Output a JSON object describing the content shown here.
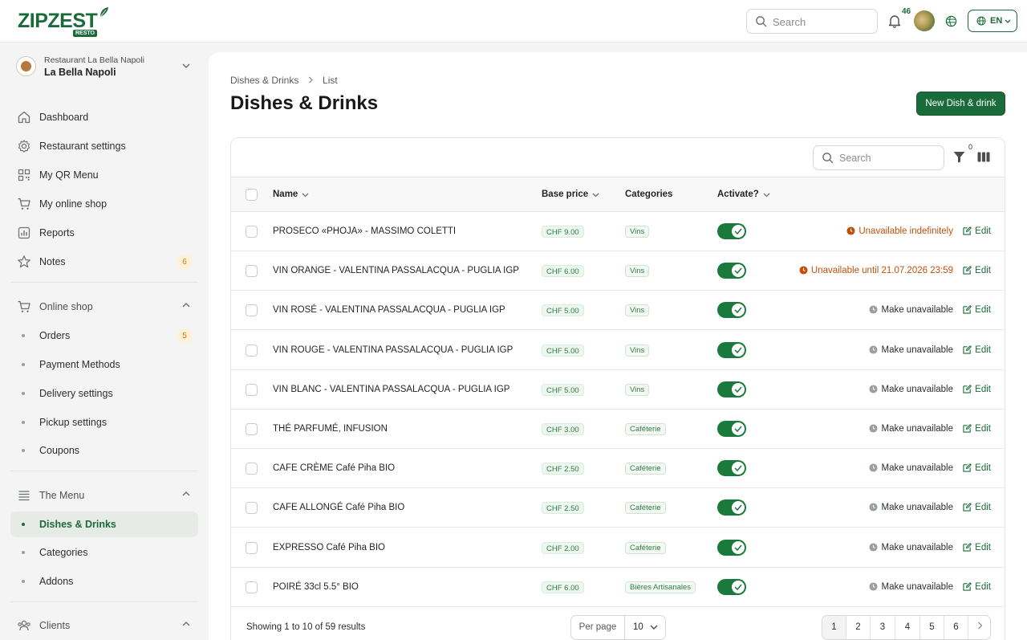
{
  "brand": {
    "name": "ZIPZEST",
    "badge": "RESTO"
  },
  "topbar": {
    "search_placeholder": "Search",
    "notifications_count": "46",
    "language": "EN"
  },
  "restaurant": {
    "subtitle": "Restaurant La Bella Napoli",
    "name": "La Bella Napoli"
  },
  "sidebar": {
    "items": [
      {
        "label": "Dashboard"
      },
      {
        "label": "Restaurant settings"
      },
      {
        "label": "My QR Menu"
      },
      {
        "label": "My online shop"
      },
      {
        "label": "Reports"
      },
      {
        "label": "Notes",
        "badge": "6"
      }
    ],
    "online_shop": {
      "label": "Online shop",
      "children": [
        {
          "label": "Orders",
          "badge": "5"
        },
        {
          "label": "Payment Methods"
        },
        {
          "label": "Delivery settings"
        },
        {
          "label": "Pickup settings"
        },
        {
          "label": "Coupons"
        }
      ]
    },
    "menu": {
      "label": "The Menu",
      "children": [
        {
          "label": "Dishes & Drinks"
        },
        {
          "label": "Categories"
        },
        {
          "label": "Addons"
        }
      ]
    },
    "clients": {
      "label": "Clients"
    }
  },
  "main": {
    "breadcrumb": [
      "Dishes & Drinks",
      "List"
    ],
    "title": "Dishes & Drinks",
    "new_button": "New Dish & drink",
    "table_search_placeholder": "Search",
    "filter_count": "0",
    "columns": {
      "name": "Name",
      "price": "Base price",
      "categories": "Categories",
      "activate": "Activate?"
    },
    "rows": [
      {
        "name": "PROSECO «PHOJA» - MASSIMO COLETTI",
        "price": "CHF 9.00",
        "category": "Vins",
        "status": "Unavailable indefinitely",
        "warn": true
      },
      {
        "name": "VIN ORANGE - VALENTINA PASSALACQUA - PUGLIA IGP",
        "price": "CHF 6.00",
        "category": "Vins",
        "status": "Unavailable until 21.07.2026 23:59",
        "warn": true
      },
      {
        "name": "VIN ROSÉ - VALENTINA PASSALACQUA - PUGLIA IGP",
        "price": "CHF 5.00",
        "category": "Vins",
        "status": "Make unavailable",
        "warn": false
      },
      {
        "name": "VIN ROUGE - VALENTINA PASSALACQUA - PUGLIA IGP",
        "price": "CHF 5.00",
        "category": "Vins",
        "status": "Make unavailable",
        "warn": false
      },
      {
        "name": "VIN BLANC - VALENTINA PASSALACQUA - PUGLIA IGP",
        "price": "CHF 5.00",
        "category": "Vins",
        "status": "Make unavailable",
        "warn": false
      },
      {
        "name": "THÉ PARFUMÉ, INFUSION",
        "price": "CHF 3.00",
        "category": "Caféterie",
        "status": "Make unavailable",
        "warn": false
      },
      {
        "name": "CAFE CRÈME Café Piha BIO",
        "price": "CHF 2.50",
        "category": "Caféterie",
        "status": "Make unavailable",
        "warn": false
      },
      {
        "name": "CAFE ALLONGÉ Café Piha BIO",
        "price": "CHF 2.50",
        "category": "Caféterie",
        "status": "Make unavailable",
        "warn": false
      },
      {
        "name": "EXPRESSO Café Piha BIO",
        "price": "CHF 2.00",
        "category": "Caféterie",
        "status": "Make unavailable",
        "warn": false
      },
      {
        "name": "POIRÉ 33cl 5.5° BIO",
        "price": "CHF 6.00",
        "category": "Bières Artisanales",
        "status": "Make unavailable",
        "warn": false
      }
    ],
    "edit_label": "Edit",
    "footer": {
      "showing": "Showing 1 to 10 of 59 results",
      "per_page_label": "Per page",
      "per_page_value": "10",
      "pages": [
        "1",
        "2",
        "3",
        "4",
        "5",
        "6"
      ]
    }
  },
  "colors": {
    "brand_green": "#1a6b3a",
    "warn_orange": "#c0510d",
    "badge_orange": "#c67a0d"
  }
}
